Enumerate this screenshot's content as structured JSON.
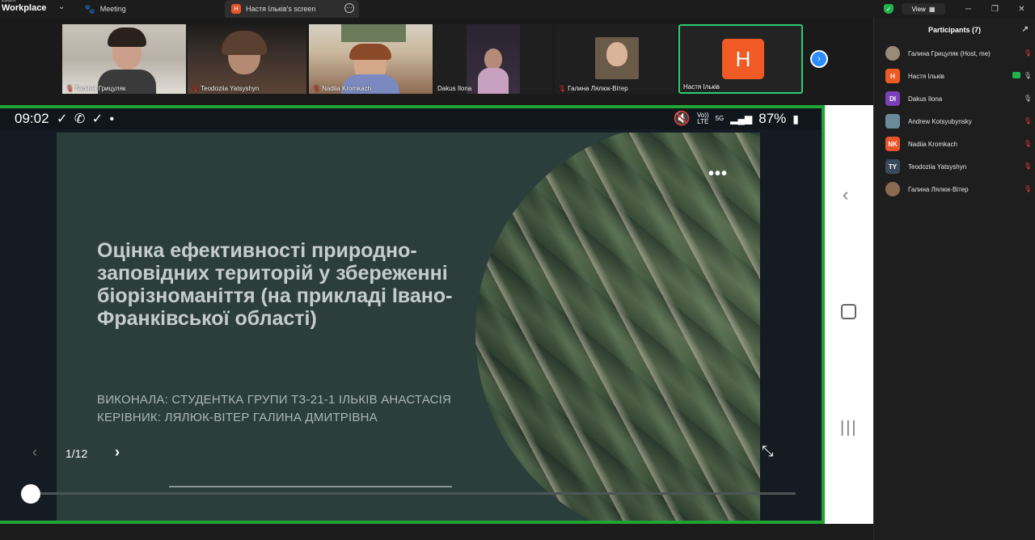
{
  "app": {
    "brand_small": "zoom",
    "brand_name": "Workplace",
    "tabs": [
      {
        "label": "Meeting",
        "icon": "paw-icon"
      },
      {
        "label": "Настя Ільків's screen",
        "icon": "H"
      }
    ],
    "view_label": "View"
  },
  "thumbnails": [
    {
      "name": "Галина Грицуляк",
      "muted": true
    },
    {
      "name": "Teodoziia Yatsyshyn",
      "muted": true
    },
    {
      "name": "Nadiia Kromkach",
      "muted": true
    },
    {
      "name": "Dakus Ilona",
      "muted": false
    },
    {
      "name": "Галина Лялюк-Вітер",
      "muted": true
    },
    {
      "name": "Настя Ільків",
      "muted": false,
      "initial": "Н"
    }
  ],
  "phone_status": {
    "time": "09:02",
    "battery": "87%",
    "net_top": "Vo))",
    "net_bottom": "LTE",
    "gen": "5G"
  },
  "slide": {
    "title": "Оцінка ефективності природно-заповідних територій у збереженні біорізноманіття (на прикладі Івано-Франківської області)",
    "line1": "ВИКОНАЛА: СТУДЕНТКА ГРУПИ ТЗ-21-1 ІЛЬКІВ АНАСТАСІЯ",
    "line2": "КЕРІВНИК: ЛЯЛЮК-ВІТЕР ГАЛИНА ДМИТРІВНА",
    "page": "1/12",
    "progress": 0.0
  },
  "participants": {
    "title": "Participants (7)",
    "items": [
      {
        "name": "Галина Грицуляк (Host, me)",
        "avatar": "",
        "color": "#9a8a7a",
        "muted": true
      },
      {
        "name": "Настя Ільків",
        "avatar": "Н",
        "color": "#ef5a25",
        "muted": false,
        "sharing": true
      },
      {
        "name": "Dakus Ilona",
        "avatar": "DI",
        "color": "#7b3fb8",
        "muted": false
      },
      {
        "name": "Andrew Kotsyubynsky",
        "avatar": "",
        "color": "#6b8a9a",
        "muted": true
      },
      {
        "name": "Nadiia Kromkach",
        "avatar": "NK",
        "color": "#e8552a",
        "muted": true
      },
      {
        "name": "Teodoziia Yatsyshyn",
        "avatar": "TY",
        "color": "#3a4a5c",
        "muted": true
      },
      {
        "name": "Галина Лялюк-Вітер",
        "avatar": "",
        "color": "#8a6a50",
        "muted": true
      }
    ]
  }
}
